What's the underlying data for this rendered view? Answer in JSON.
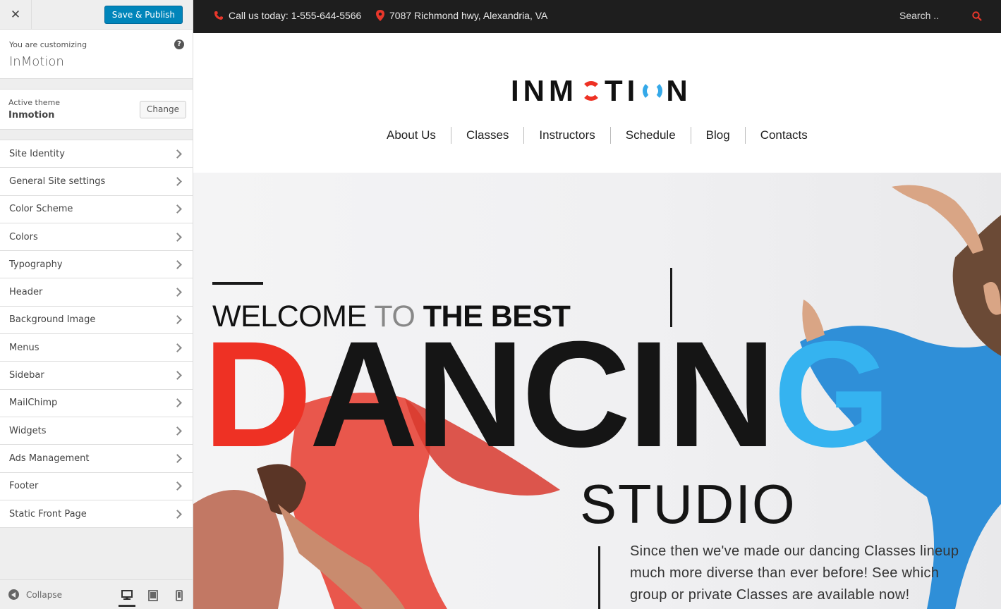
{
  "customizer": {
    "save_label": "Save & Publish",
    "customizing_label": "You are customizing",
    "site_name": "InMotion",
    "active_theme_label": "Active theme",
    "theme_name": "Inmotion",
    "change_label": "Change",
    "sections": [
      {
        "label": "Site Identity"
      },
      {
        "label": "General Site settings"
      },
      {
        "label": "Color Scheme"
      },
      {
        "label": "Colors"
      },
      {
        "label": "Typography"
      },
      {
        "label": "Header"
      },
      {
        "label": "Background Image"
      },
      {
        "label": "Menus"
      },
      {
        "label": "Sidebar"
      },
      {
        "label": "MailChimp"
      },
      {
        "label": "Widgets"
      },
      {
        "label": "Ads Management"
      },
      {
        "label": "Footer"
      },
      {
        "label": "Static Front Page"
      }
    ],
    "collapse_label": "Collapse",
    "accent_color": "#0085ba"
  },
  "site": {
    "topbar": {
      "phone": "Call us today: 1-555-644-5566",
      "address": "7087 Richmond hwy, Alexandria, VA",
      "search_placeholder": "Search ..",
      "icon_color": "#e8372b"
    },
    "logo": {
      "part1": "IN",
      "part2": "M",
      "part3": "TI",
      "part4": "N",
      "red": "#ee3124",
      "blue": "#35a9e9"
    },
    "nav": [
      {
        "label": "About Us"
      },
      {
        "label": "Classes"
      },
      {
        "label": "Instructors"
      },
      {
        "label": "Schedule"
      },
      {
        "label": "Blog"
      },
      {
        "label": "Contacts"
      }
    ],
    "hero": {
      "welcome": "WELCOME",
      "to": "TO",
      "best": "THE BEST",
      "dancing_d": "D",
      "dancing_mid": "ANCIN",
      "dancing_g": "G",
      "studio": "STUDIO",
      "description": "Since then we've made our dancing Classes lineup much more diverse than ever before! See which group or private Classes are available now!"
    }
  }
}
